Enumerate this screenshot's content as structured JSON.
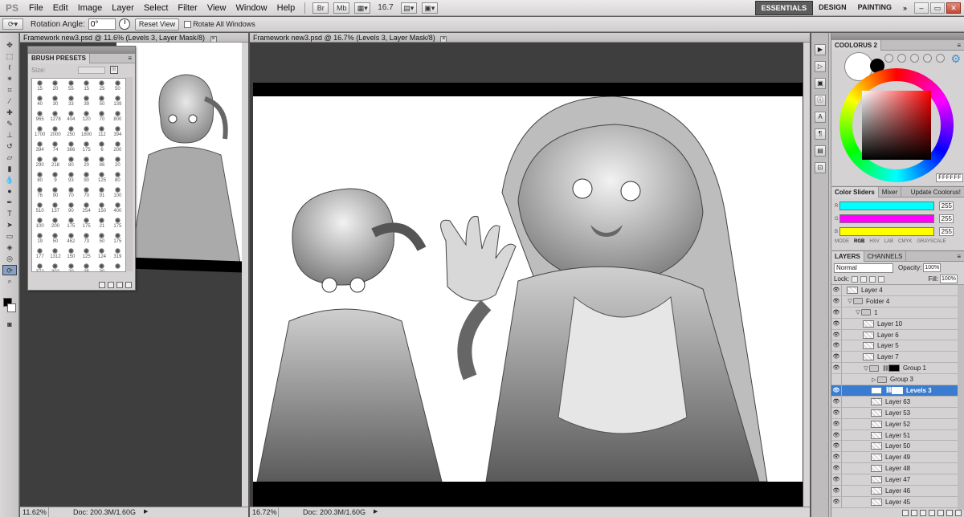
{
  "app": {
    "logo": "PS",
    "menus": [
      "File",
      "Edit",
      "Image",
      "Layer",
      "Select",
      "Filter",
      "View",
      "Window",
      "Help"
    ],
    "zoom_select": "16.7",
    "workspaces": [
      "ESSENTIALS",
      "DESIGN",
      "PAINTING"
    ],
    "active_workspace": "ESSENTIALS"
  },
  "options": {
    "rotation_label": "Rotation Angle:",
    "rotation_value": "0°",
    "reset_view": "Reset View",
    "rotate_all": "Rotate All Windows"
  },
  "doc1": {
    "tab_title": "Framework new3.psd @ 11.6% (Levels 3, Layer Mask/8)",
    "zoom": "11.62%",
    "doc_info": "Doc: 200.3M/1.60G"
  },
  "doc2": {
    "tab_title": "Framework new3.psd @ 16.7% (Levels 3, Layer Mask/8)",
    "zoom": "16.72%",
    "doc_info": "Doc: 200.3M/1.60G"
  },
  "brush_presets": {
    "title": "BRUSH PRESETS",
    "size_label": "Size:",
    "sizes": [
      "15",
      "20",
      "55",
      "15",
      "25",
      "50",
      "40",
      "30",
      "33",
      "39",
      "50",
      "139",
      "965",
      "1278",
      "404",
      "120",
      "70",
      "800",
      "1700",
      "2000",
      "250",
      "1800",
      "112",
      "394",
      "394",
      "74",
      "366",
      "175",
      "6",
      "200",
      "290",
      "218",
      "80",
      "20",
      "86",
      "20",
      "80",
      "9",
      "93",
      "90",
      "125",
      "80",
      "76",
      "90",
      "70",
      "70",
      "91",
      "100",
      "510",
      "137",
      "90",
      "254",
      "150",
      "400",
      "100",
      "200",
      "175",
      "175",
      "21",
      "175",
      "19",
      "50",
      "462",
      "73",
      "50",
      "175",
      "177",
      "1312",
      "150",
      "125",
      "124",
      "319",
      "372",
      "302",
      "20",
      "35",
      "30",
      ""
    ]
  },
  "coolorus": {
    "title": "COOLORUS 2",
    "hex": "FFFFFF",
    "tabs": [
      "Color Sliders",
      "Mixer",
      "Update Coolorus!"
    ]
  },
  "color_sliders": {
    "values": [
      "255",
      "255",
      "255"
    ],
    "modes": [
      "MODE",
      "RGB",
      "HSV",
      "LAB",
      "CMYK",
      "GRAYSCALE"
    ],
    "selected_mode": "RGB",
    "bar_colors": [
      "#00ffff",
      "#ff00ff",
      "#ffff00"
    ]
  },
  "layers_panel": {
    "tabs": [
      "LAYERS",
      "CHANNELS"
    ],
    "blend_mode": "Normal",
    "opacity_label": "Opacity:",
    "opacity": "100%",
    "lock_label": "Lock:",
    "fill_label": "Fill:",
    "fill": "100%",
    "layers": [
      {
        "name": "Layer 4",
        "kind": "layer",
        "indent": 0,
        "visible": true
      },
      {
        "name": "Folder 4",
        "kind": "folder",
        "indent": 0,
        "visible": true,
        "expanded": true
      },
      {
        "name": "1",
        "kind": "folder",
        "indent": 1,
        "visible": true,
        "expanded": true
      },
      {
        "name": "Layer 10",
        "kind": "layer",
        "indent": 2,
        "visible": true
      },
      {
        "name": "Layer 6",
        "kind": "layer",
        "indent": 2,
        "visible": true
      },
      {
        "name": "Layer 5",
        "kind": "layer",
        "indent": 2,
        "visible": true
      },
      {
        "name": "Layer 7",
        "kind": "layer",
        "indent": 2,
        "visible": true
      },
      {
        "name": "Group 1",
        "kind": "folder-mask",
        "indent": 2,
        "visible": true,
        "expanded": true
      },
      {
        "name": "Group 3",
        "kind": "folder",
        "indent": 3,
        "visible": false,
        "expanded": false
      },
      {
        "name": "Levels 3",
        "kind": "adjustment",
        "indent": 3,
        "visible": true,
        "selected": true
      },
      {
        "name": "Layer 63",
        "kind": "layer",
        "indent": 3,
        "visible": true
      },
      {
        "name": "Layer 53",
        "kind": "layer",
        "indent": 3,
        "visible": true
      },
      {
        "name": "Layer 52",
        "kind": "layer",
        "indent": 3,
        "visible": true
      },
      {
        "name": "Layer 51",
        "kind": "layer",
        "indent": 3,
        "visible": true
      },
      {
        "name": "Layer 50",
        "kind": "layer",
        "indent": 3,
        "visible": true
      },
      {
        "name": "Layer 49",
        "kind": "layer",
        "indent": 3,
        "visible": true
      },
      {
        "name": "Layer 48",
        "kind": "layer",
        "indent": 3,
        "visible": true
      },
      {
        "name": "Layer 47",
        "kind": "layer",
        "indent": 3,
        "visible": true
      },
      {
        "name": "Layer 46",
        "kind": "layer",
        "indent": 3,
        "visible": true
      },
      {
        "name": "Layer 45",
        "kind": "layer",
        "indent": 3,
        "visible": true
      }
    ]
  }
}
